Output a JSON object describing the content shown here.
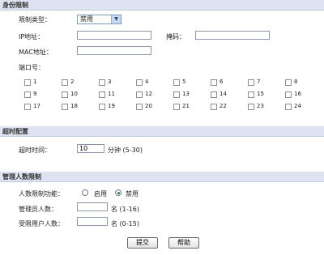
{
  "identity": {
    "title": "身份限制",
    "restrict_type_label": "限制类型：",
    "restrict_type_value": "禁用",
    "ip_label": "IP地址：",
    "ip_value": "",
    "mask_label": "掩码：",
    "mask_value": "",
    "mac_label": "MAC地址：",
    "mac_value": "",
    "port_label": "端口号：",
    "ports": [
      "1",
      "2",
      "3",
      "4",
      "5",
      "6",
      "7",
      "8",
      "9",
      "10",
      "11",
      "12",
      "13",
      "14",
      "15",
      "16",
      "17",
      "18",
      "19",
      "20",
      "21",
      "22",
      "23",
      "24"
    ]
  },
  "timeout": {
    "title": "超时配置",
    "label": "超时时间：",
    "value": "10",
    "unit": "分钟 (5-30)"
  },
  "admin": {
    "title": "管理人数限制",
    "func_label": "人数限制功能：",
    "enable_label": "启用",
    "disable_label": "禁用",
    "selected": "disable",
    "admin_count_label": "管理员人数：",
    "admin_count_value": "",
    "admin_count_unit": "名 (1-16)",
    "guest_count_label": "受限用户人数：",
    "guest_count_value": "",
    "guest_count_unit": "名 (0-15)"
  },
  "buttons": {
    "submit": "提交",
    "help": "帮助"
  }
}
